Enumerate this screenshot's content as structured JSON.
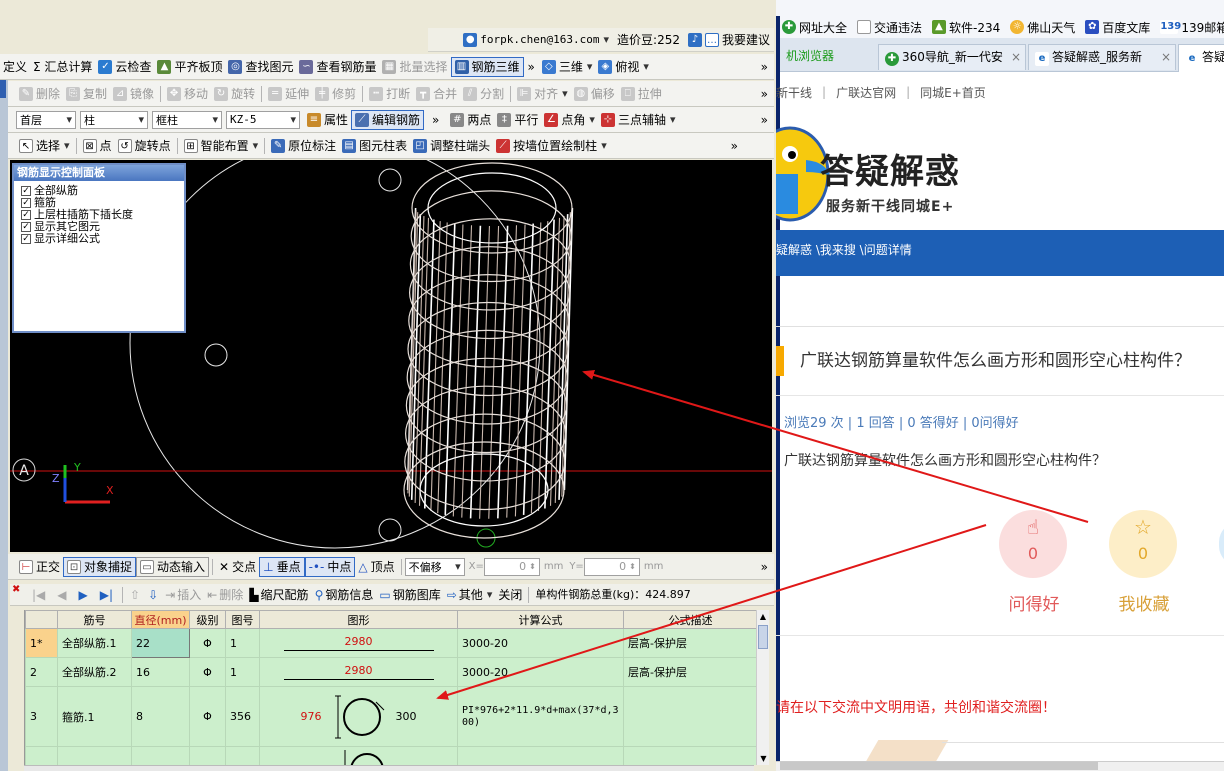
{
  "left_app": {
    "account": {
      "email": "forpk.chen@163.com",
      "bean_label": "造价豆:252",
      "suggest": "我要建议"
    },
    "menubar": {
      "items": [
        {
          "label": "定义",
          "name": "menu-define"
        },
        {
          "label": "Σ 汇总计算",
          "name": "menu-summary-calc"
        },
        {
          "label": "云检查",
          "name": "menu-cloud-check"
        },
        {
          "label": "平齐板顶",
          "name": "menu-align-slab-top"
        },
        {
          "label": "查找图元",
          "name": "menu-find-element"
        },
        {
          "label": "查看钢筋量",
          "name": "menu-view-rebar-qty"
        },
        {
          "label": "批量选择",
          "name": "menu-batch-select"
        },
        {
          "label": "钢筋三维",
          "name": "menu-rebar-3d"
        },
        {
          "label": "三维",
          "name": "menu-3d"
        },
        {
          "label": "俯视",
          "name": "menu-top-view"
        }
      ]
    },
    "edit_toolbar": {
      "items": [
        {
          "label": "删除",
          "name": "delete"
        },
        {
          "label": "复制",
          "name": "copy"
        },
        {
          "label": "镜像",
          "name": "mirror"
        },
        {
          "label": "移动",
          "name": "move"
        },
        {
          "label": "旋转",
          "name": "rotate"
        },
        {
          "label": "延伸",
          "name": "extend"
        },
        {
          "label": "修剪",
          "name": "trim"
        },
        {
          "label": "打断",
          "name": "break"
        },
        {
          "label": "合并",
          "name": "merge"
        },
        {
          "label": "分割",
          "name": "split"
        },
        {
          "label": "对齐",
          "name": "align"
        },
        {
          "label": "偏移",
          "name": "offset"
        },
        {
          "label": "拉伸",
          "name": "stretch"
        }
      ]
    },
    "layer_toolbar": {
      "floor": "首层",
      "type": "柱",
      "subtype": "框柱",
      "element": "KZ-5",
      "properties": "属性",
      "edit_rebar": "编辑钢筋",
      "two_point": "两点",
      "parallel": "平行",
      "point_angle": "点角",
      "three_point_aux": "三点辅轴"
    },
    "draw_toolbar": {
      "select": "选择",
      "point": "点",
      "rotate_point": "旋转点",
      "smart_layout": "智能布置",
      "in_situ_mark": "原位标注",
      "element_column_table": "图元柱表",
      "adjust_column_end": "调整柱端头",
      "draw_by_wall": "按墙位置绘制柱"
    },
    "rebar_panel": {
      "title": "钢筋显示控制面板",
      "options": [
        "全部纵筋",
        "箍筋",
        "上层柱插筋下插长度",
        "显示其它图元",
        "显示详细公式"
      ]
    },
    "axis_label": "A",
    "snap_toolbar": {
      "ortho": "正交",
      "object_snap": "对象捕捉",
      "dynamic_input": "动态输入",
      "intersection": "交点",
      "perpendicular": "垂点",
      "midpoint": "中点",
      "vertex": "顶点",
      "offset_mode": "不偏移",
      "x_label": "X=",
      "x_value": "0",
      "y_label": "Y=",
      "y_value": "0",
      "unit": "mm"
    },
    "rebar_toolbar": {
      "insert": "插入",
      "delete": "删除",
      "scale_rebar": "缩尺配筋",
      "rebar_info": "钢筋信息",
      "rebar_library": "钢筋图库",
      "other": "其他",
      "close": "关闭",
      "total_weight": "单构件钢筋总重(kg)：424.897"
    },
    "table": {
      "headers": [
        "",
        "筋号",
        "直径(mm)",
        "级别",
        "图号",
        "图形",
        "计算公式",
        "公式描述"
      ],
      "rows": [
        {
          "idx": "1*",
          "name": "全部纵筋.1",
          "dia": "22",
          "grade": "Φ",
          "fig": "1",
          "shape_len": "2980",
          "formula": "3000-20",
          "desc": "层高-保护层"
        },
        {
          "idx": "2",
          "name": "全部纵筋.2",
          "dia": "16",
          "grade": "Φ",
          "fig": "1",
          "shape_len": "2980",
          "formula": "3000-20",
          "desc": "层高-保护层"
        },
        {
          "idx": "3",
          "name": "箍筋.1",
          "dia": "8",
          "grade": "Φ",
          "fig": "356",
          "shape_h": "976",
          "shape_w": "300",
          "formula": "PI*976+2*11.9*d+max(37*d,300)",
          "desc": ""
        }
      ]
    }
  },
  "browser": {
    "bookmarks": [
      "网址大全",
      "交通违法",
      "软件-234",
      "佛山天气",
      "百度文库",
      "139邮箱"
    ],
    "tabs": [
      "机浏览器",
      "360导航_新一代安",
      "答疑解惑_服务新",
      "答疑"
    ],
    "nav_links": [
      "新干线",
      "广联达官网",
      "同城E+首页"
    ],
    "brand_title": "答疑解惑",
    "brand_sub": "服务新干线同城E+",
    "breadcrumb": "疑解惑 \\我来搜 \\问题详情",
    "question_title": "广联达钢筋算量软件怎么画方形和圆形空心柱构件？",
    "stats": "浏览29 次 | 1 回答 | 0 答得好 | 0问得好",
    "question_body": "广联达钢筋算量软件怎么画方形和圆形空心柱构件？",
    "good_ask": {
      "count": "0",
      "label": "问得好"
    },
    "favorite": {
      "count": "0",
      "label": "我收藏"
    },
    "notice": "请在以下交流中文明用语，共创和谐交流圈！"
  },
  "colors": {
    "accent_blue": "#1d5fb5",
    "annotation_red": "#e01818",
    "grid_green": "#ccefcc",
    "heading_orange": "#f7a900"
  }
}
